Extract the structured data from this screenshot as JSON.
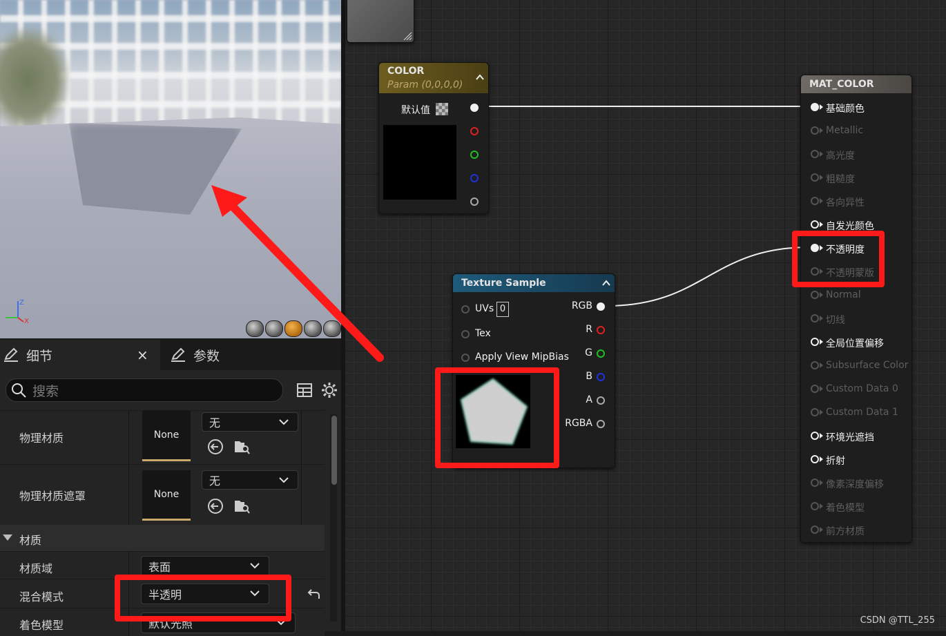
{
  "viewport": {
    "view_modes": [
      "cylinder",
      "sphere",
      "plane",
      "cube",
      "teapot"
    ],
    "active_view_mode": "plane",
    "gizmo_axes": {
      "z": "Z",
      "x": "X"
    }
  },
  "details": {
    "tabs": [
      {
        "label": "细节",
        "icon": "pencil-icon"
      },
      {
        "label": "参数",
        "icon": "pencil-icon"
      }
    ],
    "close": "×",
    "search_placeholder": "搜索",
    "properties": [
      {
        "label": "物理材质",
        "thumb": "None",
        "dropdown": "无"
      },
      {
        "label": "物理材质遮罩",
        "thumb": "None",
        "dropdown": "无"
      }
    ],
    "section": "材质",
    "material": [
      {
        "label": "材质域",
        "value": "表面"
      },
      {
        "label": "混合模式",
        "value": "半透明"
      },
      {
        "label": "着色模型",
        "value": "默认光照"
      }
    ]
  },
  "graph": {
    "color_node": {
      "title": "COLOR",
      "subtitle": "Param (0,0,0,0)",
      "default_label": "默认值",
      "pins": [
        "white",
        "red",
        "green",
        "blue",
        "alpha"
      ]
    },
    "texture_node": {
      "title": "Texture Sample",
      "inputs": [
        {
          "label": "UVs",
          "value": "0"
        },
        {
          "label": "Tex"
        },
        {
          "label": "Apply View MipBias"
        }
      ],
      "outputs": [
        {
          "label": "RGB",
          "color": "#f0f0f0"
        },
        {
          "label": "R",
          "color": "#e02020"
        },
        {
          "label": "G",
          "color": "#20c020"
        },
        {
          "label": "B",
          "color": "#2030e0"
        },
        {
          "label": "A",
          "color": "#a0a0a0"
        },
        {
          "label": "RGBA",
          "color": "#a0a0a0"
        }
      ]
    },
    "result_node": {
      "title": "MAT_COLOR",
      "inputs": [
        {
          "label": "基础颜色",
          "active": true,
          "connected": true
        },
        {
          "label": "Metallic",
          "active": false
        },
        {
          "label": "高光度",
          "active": false
        },
        {
          "label": "粗糙度",
          "active": false
        },
        {
          "label": "各向异性",
          "active": false
        },
        {
          "label": "自发光颜色",
          "active": true
        },
        {
          "label": "不透明度",
          "active": true,
          "connected": true
        },
        {
          "label": "不透明蒙版",
          "active": false
        },
        {
          "label": "Normal",
          "active": false
        },
        {
          "label": "切线",
          "active": false
        },
        {
          "label": "全局位置偏移",
          "active": true
        },
        {
          "label": "Subsurface Color",
          "active": false
        },
        {
          "label": "Custom Data 0",
          "active": false
        },
        {
          "label": "Custom Data 1",
          "active": false
        },
        {
          "label": "环境光遮挡",
          "active": true
        },
        {
          "label": "折射",
          "active": true
        },
        {
          "label": "像素深度偏移",
          "active": false
        },
        {
          "label": "着色模型",
          "active": false
        },
        {
          "label": "前方材质",
          "active": false
        }
      ]
    }
  },
  "annotation_color": "#ff1a1a",
  "watermark": "CSDN @TTL_255"
}
